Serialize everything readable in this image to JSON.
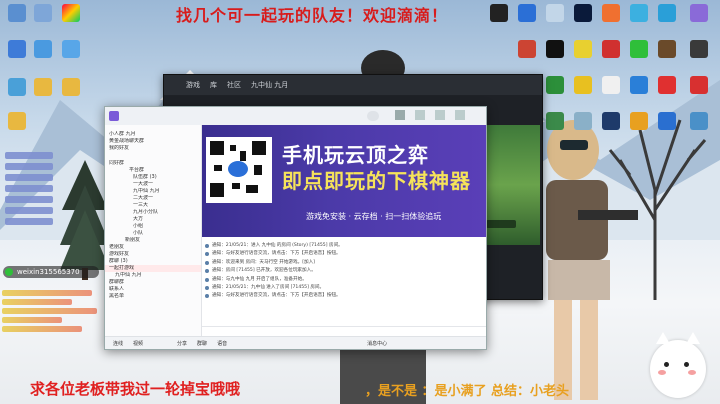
{
  "overlay": {
    "headline": "找几个可一起玩的队友！欢迎滴滴！",
    "footer_left": "求各位老板带我过一轮掉宝哦哦",
    "footer_right": "，是不是 ：是小满了 总结：小老头",
    "wechat": "weixin315565370"
  },
  "back_window": {
    "tabs": [
      "游戏",
      "库",
      "社区",
      "九中仙 九月"
    ]
  },
  "chat_window": {
    "contacts": [
      "小人群 九月",
      "黄金战场聊天群",
      "我的好友",
      "同好群",
      "平台群",
      "队伍群 (3)",
      "一大波一",
      "九中仙 九月",
      "二大波一",
      "一三大",
      "九月小分队",
      "大方",
      "小组",
      "小队",
      "新朋友",
      "老朋友",
      "游戏好友",
      "群聊 (3)",
      "一起打游戏",
      "九中仙 九月",
      "群聊群",
      "联系人",
      "黑名单"
    ],
    "banner": {
      "title_line1": "手机玩云顶之弈",
      "title_line2": "即点即玩的下棋神器",
      "subtitle": "游戏免安装 · 云存档 · 扫一扫体验追玩"
    },
    "messages": [
      "通知：21/05/21：进入 九中仙 的房间 (Story) [71455] 房间。",
      "通知：与好友进行语音交流，请点击：下方【开启语音】按钮。",
      "通知：欢迎来到 房间：天马行空 开始游戏。[加入]",
      "通知：房间 [71455] 已开放，欢迎各位玩家加入。",
      "通知：与九中仙 九月 开启了组队，准备开始。",
      "通知：21/05/21：九中仙 进入了房间 [71455] 房间。",
      "通知：与好友进行语音交流，请点击：下方【开启语音】按钮。"
    ],
    "bottom_bar": [
      "连线",
      "视频",
      "分享",
      "群聊",
      "语音",
      "消息中心"
    ]
  },
  "colors": {
    "headline": "#d81c1c",
    "footer_left": "#e02020",
    "footer_right": "#e8a020",
    "banner_bg": "#4b3aa8",
    "banner_accent": "#f6e35a"
  }
}
